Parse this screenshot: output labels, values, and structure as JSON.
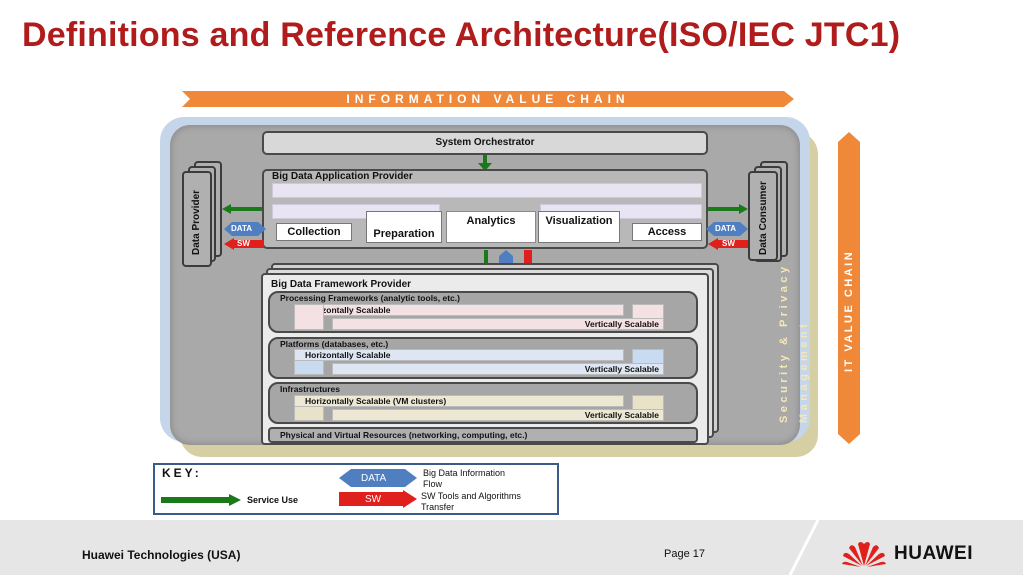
{
  "title": "Definitions and Reference Architecture(ISO/IEC JTC1)",
  "information_value_chain": "INFORMATION VALUE CHAIN",
  "it_value_chain": "IT VALUE CHAIN",
  "security_line1": "Security & Privacy",
  "security_line2": "Management",
  "system_orchestrator": "System Orchestrator",
  "app_provider": {
    "label": "Big Data Application Provider",
    "cells": [
      "Collection",
      "Preparation",
      "Analytics",
      "Visualization",
      "Access"
    ]
  },
  "data_provider": "Data Provider",
  "data_consumer": "Data Consumer",
  "data_tag": "DATA",
  "sw_tag": "SW",
  "framework": {
    "label": "Big Data Framework Provider",
    "processing": "Processing Frameworks (analytic tools, etc.)",
    "platforms": "Platforms (databases, etc.)",
    "infrastructures": "Infrastructures",
    "horizontal": "Horizontally Scalable",
    "horizontal_vm": "Horizontally Scalable (VM clusters)",
    "vertical": "Vertically Scalable",
    "physical": "Physical and Virtual Resources (networking, computing, etc.)"
  },
  "key": {
    "title": "KEY:",
    "service_use": "Service Use",
    "data_label": "DATA",
    "sw_label": "SW",
    "data_desc_1": "Big Data Information",
    "data_desc_2": "Flow",
    "sw_desc_1": "SW Tools and Algorithms",
    "sw_desc_2": "Transfer"
  },
  "footer": {
    "company": "Huawei Technologies (USA)",
    "page": "Page 17",
    "logo": "HUAWEI"
  },
  "colors": {
    "title": "#b01c1c",
    "orange": "#f0883a",
    "data_blue": "#4f7fc0",
    "sw_red": "#e0201c",
    "arrow_green": "#1a7a1a"
  }
}
